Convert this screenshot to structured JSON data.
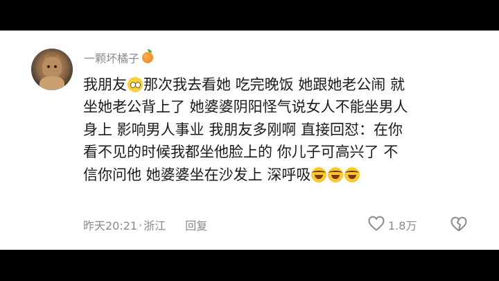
{
  "comment": {
    "username": "一颗坏橘子",
    "username_badge_icon": "orange-icon",
    "line1_a": "我朋友",
    "line1_emoji": "pleading-face-emoji",
    "line1_b": "那次我去看她 吃完晚饭 她跟她老公闹 就",
    "line2": "坐她老公背上了 她婆婆阴阳怪气说女人不能坐男人",
    "line3": "身上 影响男人事业 我朋友多刚啊 直接回怼：在你",
    "line4": "看不见的时候我都坐他脸上的 你儿子可高兴了 不",
    "line5": "信你问他 她婆婆坐在沙发上 深呼吸",
    "line5_emojis": [
      "laughing-crying-emoji",
      "laughing-crying-emoji",
      "laughing-crying-emoji"
    ],
    "timestamp": "昨天20:21",
    "separator": "·",
    "location": "浙江",
    "reply_label": "回复",
    "like_count": "1.8万"
  },
  "colors": {
    "background": "#000000",
    "card": "#ffffff",
    "text": "#1a1a1a",
    "muted": "#8a8a8a"
  }
}
